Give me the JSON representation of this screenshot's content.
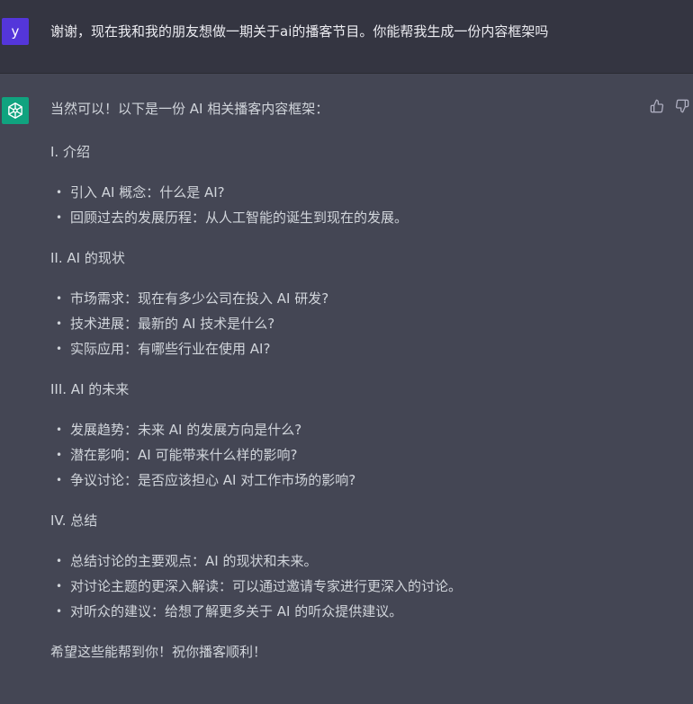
{
  "user": {
    "avatar_letter": "y",
    "message": "谢谢，现在我和我的朋友想做一期关于ai的播客节目。你能帮我生成一份内容框架吗"
  },
  "assistant": {
    "intro": "当然可以！以下是一份 AI 相关播客内容框架：",
    "sections": [
      {
        "heading": "I. 介绍",
        "items": [
          "引入 AI 概念：什么是 AI?",
          "回顾过去的发展历程：从人工智能的诞生到现在的发展。"
        ]
      },
      {
        "heading": "II. AI 的现状",
        "items": [
          "市场需求：现在有多少公司在投入 AI 研发?",
          "技术进展：最新的 AI 技术是什么?",
          "实际应用：有哪些行业在使用 AI?"
        ]
      },
      {
        "heading": "III. AI 的未来",
        "items": [
          "发展趋势：未来 AI 的发展方向是什么?",
          "潜在影响：AI 可能带来什么样的影响?",
          "争议讨论：是否应该担心 AI 对工作市场的影响?"
        ]
      },
      {
        "heading": "IV. 总结",
        "items": [
          "总结讨论的主要观点：AI 的现状和未来。",
          "对讨论主题的更深入解读：可以通过邀请专家进行更深入的讨论。",
          "对听众的建议：给想了解更多关于 AI 的听众提供建议。"
        ]
      }
    ],
    "closing": "希望这些能帮到你！祝你播客顺利！",
    "bullet_glyph": "•"
  },
  "icons": {
    "assistant_avatar": "openai-logo-icon",
    "thumbs_up": "thumbs-up-icon",
    "thumbs_down": "thumbs-down-icon"
  },
  "colors": {
    "user_bg": "#343541",
    "assistant_bg": "#444654",
    "user_avatar": "#5436da",
    "assistant_avatar": "#10a37f"
  }
}
